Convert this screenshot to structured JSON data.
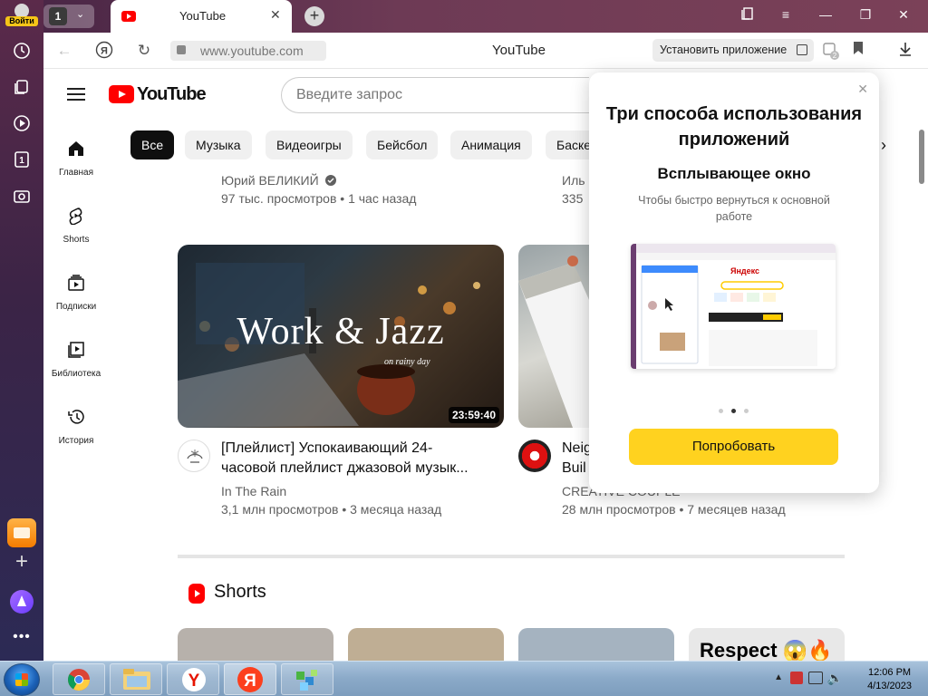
{
  "browser": {
    "login_label": "Войти",
    "tab_count": "1",
    "tab_title": "YouTube",
    "url": "www.youtube.com",
    "page_title": "YouTube",
    "install_app_label": "Установить приложение",
    "bookmarks_badge": "2"
  },
  "youtube": {
    "logo_text": "YouTube",
    "search_placeholder": "Введите запрос",
    "guide": [
      {
        "label": "Главная",
        "icon": "home-icon"
      },
      {
        "label": "Shorts",
        "icon": "shorts-icon"
      },
      {
        "label": "Подписки",
        "icon": "subscriptions-icon"
      },
      {
        "label": "Библиотека",
        "icon": "library-icon"
      },
      {
        "label": "История",
        "icon": "history-icon"
      }
    ],
    "chips": [
      "Все",
      "Музыка",
      "Видеоигры",
      "Бейсбол",
      "Анимация",
      "Баске"
    ],
    "top_row": [
      {
        "channel": "Юрий ВЕЛИКИЙ",
        "stats": "97 тыс. просмотров • 1 час назад",
        "verified": true
      },
      {
        "channel": "Иль",
        "stats": "335"
      }
    ],
    "videos": [
      {
        "thumb_text": "Work & Jazz",
        "thumb_subtext": "on rainy day",
        "duration": "23:59:40",
        "title_line1": "[Плейлист] Успокаивающий 24-",
        "title_line2": "часовой плейлист джазовой музык...",
        "channel": "In The Rain",
        "stats": "3,1 млн просмотров • 3 месяца назад"
      },
      {
        "title_line1": "Neig",
        "title_line2": "Buil",
        "channel": "CREATIVE COUPLE",
        "stats": "28 млн просмотров • 7 месяцев назад"
      }
    ],
    "shorts_heading": "Shorts",
    "shorts_thumb_text": "Respect 😱🔥"
  },
  "promo": {
    "title": "Три способа использования приложений",
    "subtitle": "Всплывающее окно",
    "description": "Чтобы быстро вернуться к основной работе",
    "illustration_brand": "Яндекс",
    "button_label": "Попробовать",
    "active_dot": 2
  },
  "taskbar": {
    "time": "12:06 PM",
    "date": "4/13/2023"
  },
  "colors": {
    "youtube_red": "#ff0000",
    "promo_button": "#ffd21f",
    "chip_active": "#0f0f0f"
  }
}
